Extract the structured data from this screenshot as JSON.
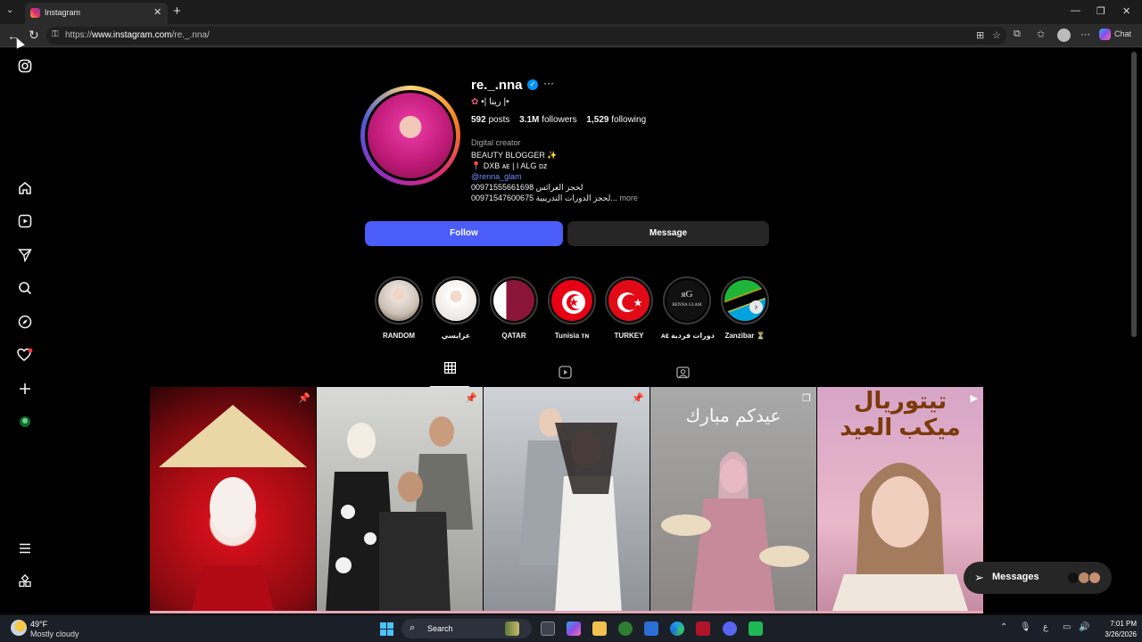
{
  "browser": {
    "tab_title": "Instagram",
    "url_prefix": "https://",
    "url_domain": "www.instagram.com",
    "url_path": "/re._.nna/",
    "chat_label": "Chat"
  },
  "profile": {
    "username": "re._.nna",
    "display_name": "•| رينا |•",
    "posts_count": "592",
    "posts_label": "posts",
    "followers_count": "3.1M",
    "followers_label": "followers",
    "following_count": "1,529",
    "following_label": "following",
    "category": "Digital creator",
    "bio_line1": "BEAUTY BLOGGER ✨",
    "bio_line2": "📍 DXB ᴀᴇ | I ALG ᴅᴢ",
    "bio_link": "@renna_glam",
    "bio_line3": "00971555661698 لحجز العرائس",
    "bio_line4": "00971547600675 لحجز الدورات التدريبية...",
    "bio_more": "more",
    "follow_label": "Follow",
    "message_label": "Message"
  },
  "highlights": [
    {
      "label": "RANDOM"
    },
    {
      "label": "عرايسي"
    },
    {
      "label": "QATAR"
    },
    {
      "label": "Tunisia ᴛɴ"
    },
    {
      "label": "TURKEY"
    },
    {
      "label": "ᴀᴇ دورات فردية"
    },
    {
      "label": "Zanzibar ⏳"
    }
  ],
  "highlight_logo_text": "RENNA GLAM",
  "posts": [
    {
      "id": "post-1",
      "badge": "pin"
    },
    {
      "id": "post-2",
      "badge": "pin"
    },
    {
      "id": "post-3",
      "badge": "pin"
    },
    {
      "id": "post-4",
      "badge": "carousel",
      "overlay_text": "عيدكم مبارك"
    },
    {
      "id": "post-5",
      "badge": "reel",
      "overlay_text_1": "تيتوريال",
      "overlay_text_2": "ميكب العيد"
    }
  ],
  "messages_pill": {
    "label": "Messages"
  },
  "taskbar": {
    "temperature": "49°F",
    "weather": "Mostly cloudy",
    "search_label": "Search",
    "time": "7:01 PM",
    "date": "3/26/2026",
    "lang": "ع"
  },
  "colors": {
    "follow_button": "#4a5df9",
    "background": "#000000",
    "link": "#6d8dff"
  }
}
